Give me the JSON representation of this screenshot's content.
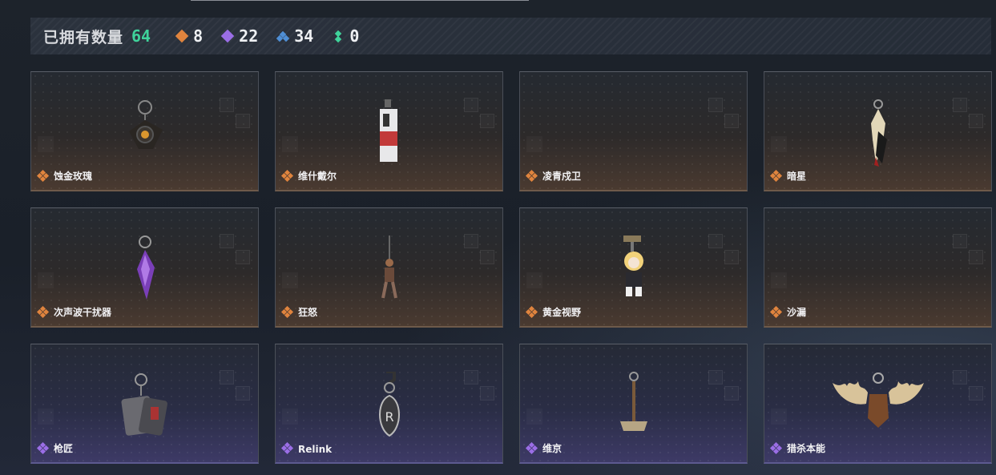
{
  "summary": {
    "owned_label": "已拥有数量",
    "owned_count": "64",
    "rarities": [
      {
        "icon": "orange-diamond-icon",
        "color": "#e0843e",
        "count": "8"
      },
      {
        "icon": "purple-diamond-icon",
        "color": "#9b6ee6",
        "count": "22"
      },
      {
        "icon": "blue-diamond-icon",
        "color": "#4f8fd6",
        "count": "34"
      },
      {
        "icon": "green-diamond-icon",
        "color": "#3fd39b",
        "count": "0"
      }
    ]
  },
  "items": [
    {
      "name": "蚀金玫瑰",
      "tier": "orange",
      "icon": "rose-charm-icon"
    },
    {
      "name": "维什戴尔",
      "tier": "orange",
      "icon": "card-charm-icon"
    },
    {
      "name": "凌青戍卫",
      "tier": "orange",
      "icon": ""
    },
    {
      "name": "暗星",
      "tier": "orange",
      "icon": "feather-charm-icon"
    },
    {
      "name": "次声波干扰器",
      "tier": "orange",
      "icon": "crystal-charm-icon"
    },
    {
      "name": "狂怒",
      "tier": "orange",
      "icon": "figure-charm-icon"
    },
    {
      "name": "黄金视野",
      "tier": "orange",
      "icon": "chibi-charm-icon"
    },
    {
      "name": "沙漏",
      "tier": "orange",
      "icon": ""
    },
    {
      "name": "枪匠",
      "tier": "purple",
      "icon": "tags-charm-icon"
    },
    {
      "name": "Relink",
      "tier": "purple",
      "icon": "emblem-charm-icon"
    },
    {
      "name": "维京",
      "tier": "purple",
      "icon": "hammer-charm-icon"
    },
    {
      "name": "猎杀本能",
      "tier": "purple",
      "icon": "antler-charm-icon"
    }
  ],
  "tier_colors": {
    "orange": "#e0843e",
    "purple": "#9b6ee6"
  }
}
